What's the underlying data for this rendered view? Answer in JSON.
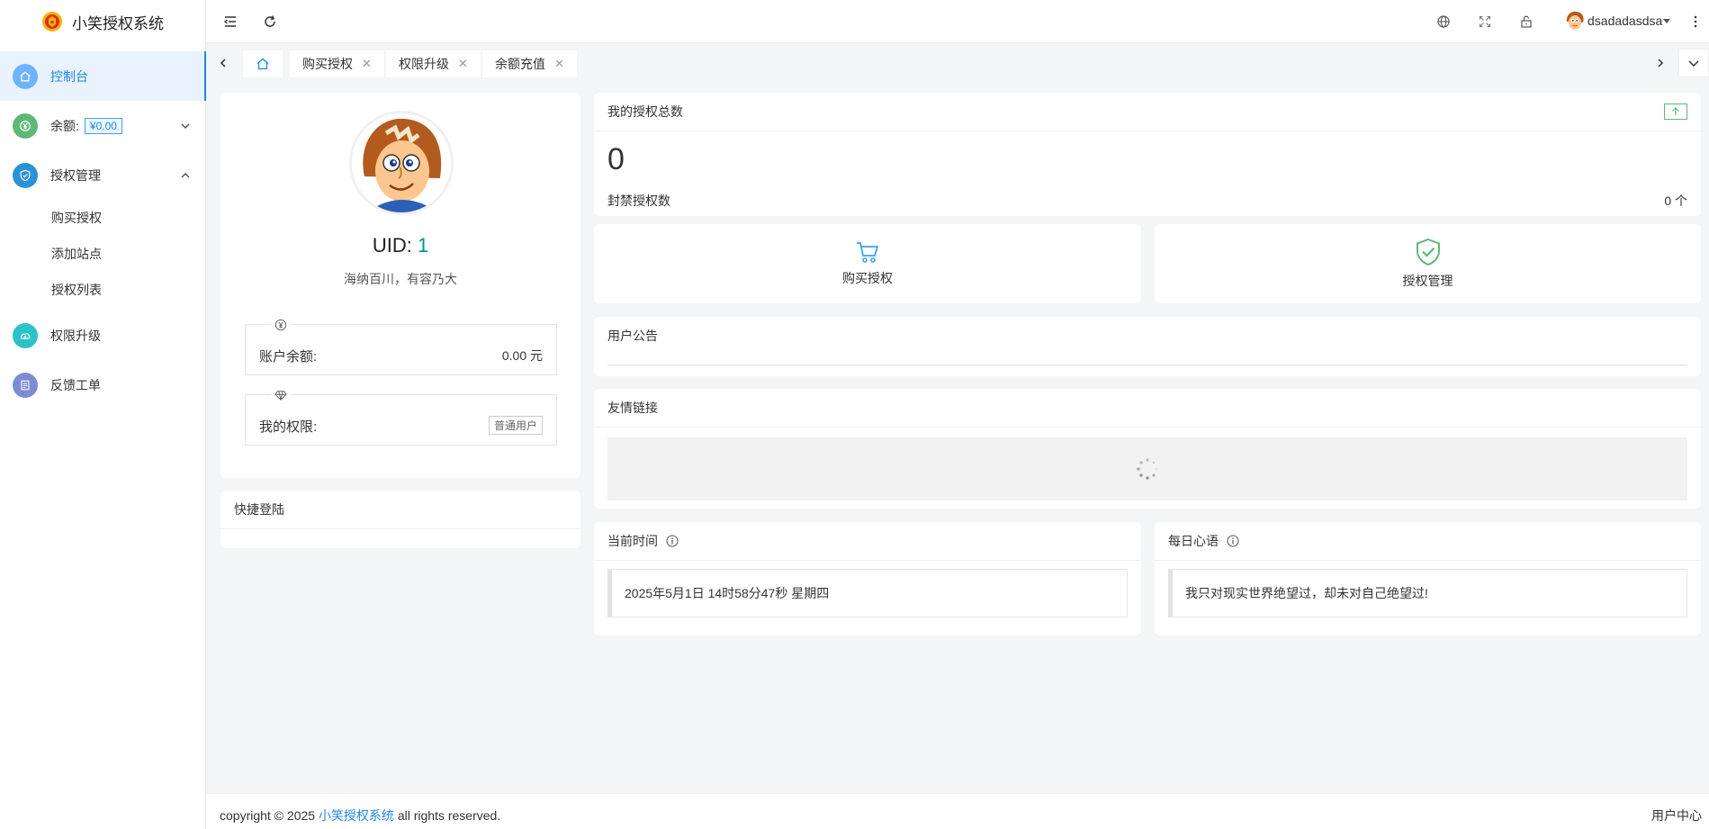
{
  "app": {
    "title": "小笑授权系统"
  },
  "sidebar": {
    "dashboard": "控制台",
    "balance_label": "余额:",
    "balance_value": "¥0.00",
    "auth_manage": "授权管理",
    "sub_items": [
      "购买授权",
      "添加站点",
      "授权列表"
    ],
    "upgrade": "权限升级",
    "feedback": "反馈工单"
  },
  "header": {
    "username": "dsadadasdsa"
  },
  "tabs": [
    {
      "label": "购买授权"
    },
    {
      "label": "权限升级"
    },
    {
      "label": "余额充值"
    }
  ],
  "profile": {
    "uid_label": "UID:",
    "uid_value": "1",
    "motto": "海纳百川，有容乃大",
    "balance_label": "账户余额:",
    "balance_value": "0.00 元",
    "permission_label": "我的权限:",
    "permission_value": "普通用户"
  },
  "quick_login": {
    "title": "快捷登陆"
  },
  "stats": {
    "title": "我的授权总数",
    "total": "0",
    "banned_label": "封禁授权数",
    "banned_value": "0 个"
  },
  "quick_actions": {
    "buy": "购买授权",
    "manage": "授权管理"
  },
  "notice": {
    "title": "用户公告"
  },
  "links": {
    "title": "友情链接"
  },
  "time": {
    "title": "当前时间",
    "value": "2025年5月1日 14时58分47秒 星期四"
  },
  "quote": {
    "title": "每日心语",
    "value": "我只对现实世界绝望过，却未对自己绝望过!"
  },
  "footer": {
    "prefix": "copyright © 2025",
    "brand": "小笑授权系统",
    "suffix": "all rights reserved.",
    "right": "用户中心"
  },
  "colors": {
    "primary": "#1e88e5",
    "uid_accent": "#009688",
    "balance_icon": "#5fb878",
    "upgrade_icon": "#2bc3c6",
    "feedback_icon": "#7d8bd4"
  }
}
